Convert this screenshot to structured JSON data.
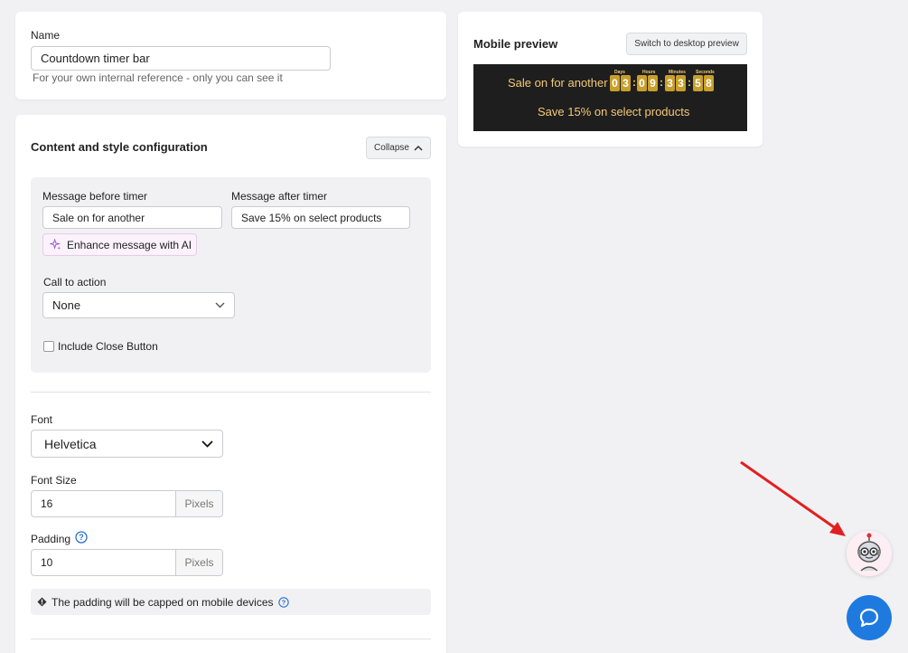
{
  "name_card": {
    "label": "Name",
    "value": "Countdown timer bar",
    "hint": "For your own internal reference - only you can see it"
  },
  "config": {
    "title": "Content and style configuration",
    "collapse_label": "Collapse",
    "message_before_label": "Message before timer",
    "message_before_value": "Sale on for another",
    "message_after_label": "Message after timer",
    "message_after_value": "Save 15% on select products",
    "ai_button_label": "Enhance message with AI",
    "cta_label": "Call to action",
    "cta_value": "None",
    "close_button_label": "Include Close Button",
    "font_label": "Font",
    "font_value": "Helvetica",
    "font_size_label": "Font Size",
    "font_size_value": "16",
    "font_size_unit": "Pixels",
    "padding_label": "Padding",
    "padding_value": "10",
    "padding_unit": "Pixels",
    "padding_note": "The padding will be capped on mobile devices"
  },
  "preview": {
    "title": "Mobile preview",
    "switch_label": "Switch to desktop preview",
    "message_before": "Sale on for another",
    "message_after": "Save 15% on select products",
    "units": [
      "Days",
      "Hours",
      "Minutes",
      "Seconds"
    ],
    "digits": [
      "0",
      "3",
      "0",
      "9",
      "3",
      "3",
      "5",
      "8"
    ],
    "colors": {
      "bar_bg": "#1e1e1e",
      "text": "#f5c978",
      "digit_bg": "#c79f2b"
    }
  },
  "icons": {
    "collapse": "chevron-up-icon",
    "ai": "sparkle-icon",
    "select": "chevron-down-icon",
    "help": "question-circle-icon",
    "info": "exclamation-diamond-icon",
    "robot": "robot-assistant-icon",
    "chat": "chat-bubble-icon",
    "arrow": "red-arrow-icon"
  }
}
